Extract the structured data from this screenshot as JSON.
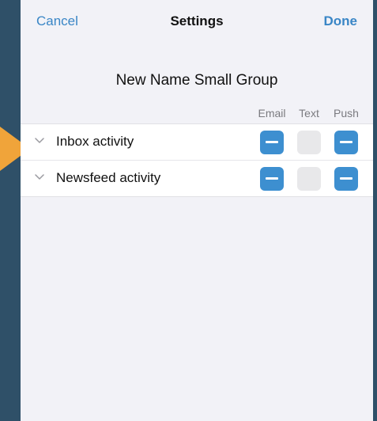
{
  "nav": {
    "cancel_label": "Cancel",
    "title": "Settings",
    "done_label": "Done"
  },
  "group_name": "New Name Small Group",
  "columns": [
    "Email",
    "Text",
    "Push"
  ],
  "rows": [
    {
      "label": "Inbox activity",
      "email": "on",
      "text": "off",
      "push": "on"
    },
    {
      "label": "Newsfeed activity",
      "email": "on",
      "text": "off",
      "push": "on"
    }
  ],
  "colors": {
    "accent": "#3a86c6",
    "toggle_on": "#3d8fd0",
    "callout": "#f0a43a",
    "background": "#2f5068"
  },
  "icons": {
    "row_expand": "chevron-down-icon",
    "toggle_on_glyph": "minus-icon"
  }
}
